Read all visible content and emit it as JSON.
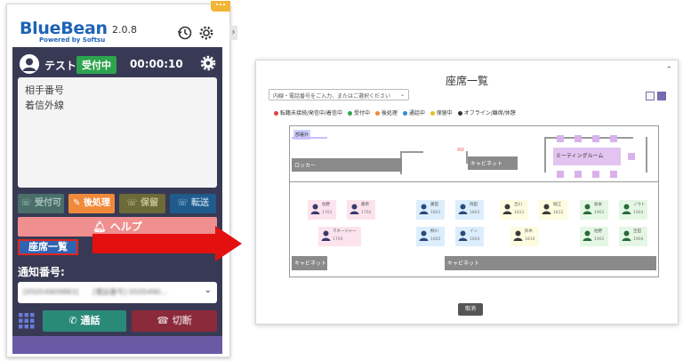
{
  "app": {
    "name": "BlueBean",
    "version": "2.0.8",
    "powered_by": "Powered by Softsu"
  },
  "user": {
    "name": "テスト",
    "status": "受付中",
    "timer": "00:00:10"
  },
  "call_info": {
    "line1": "相手番号",
    "line2": "着信外線"
  },
  "actions": {
    "receive": "受付可",
    "after": "後処理",
    "hold": "保留",
    "transfer": "転送",
    "help": "ヘルプ",
    "seat_list": "座席一覧"
  },
  "notify": {
    "label": "通知番号:",
    "value": "[05054909883]　　[電話番号] 0505490…"
  },
  "bottom": {
    "call": "通話",
    "hangup": "切断"
  },
  "seat_window": {
    "title": "座席一覧",
    "filter_placeholder": "内線・電話番号をご入力、またはご選択ください",
    "legend": [
      {
        "label": "転籍未接続/発信中/着信中",
        "color": "#e04040"
      },
      {
        "label": "受付中",
        "color": "#2da44e"
      },
      {
        "label": "後処理",
        "color": "#f08a3a"
      },
      {
        "label": "通話中",
        "color": "#2f8fd8"
      },
      {
        "label": "保留中",
        "color": "#e8c020"
      },
      {
        "label": "オフライン/離席/休憩",
        "color": "#333333"
      }
    ],
    "rooms": {
      "room_label": "部署外",
      "locker": "ロッカー",
      "cabinet_top": "キャビネット",
      "meeting": "ミーティングルーム",
      "cabinet_left": "キャビネット",
      "cabinet_bottom": "キャビネット"
    },
    "seats": [
      {
        "name": "佐野",
        "ext": "1701"
      },
      {
        "name": "藤原",
        "ext": "1702"
      },
      {
        "name": "マネージャー",
        "ext": "1700"
      },
      {
        "name": "藤田",
        "ext": "1801"
      },
      {
        "name": "岡田",
        "ext": "1803"
      },
      {
        "name": "柳川",
        "ext": "1802"
      },
      {
        "name": "イン",
        "ext": "1804"
      },
      {
        "name": "吉川",
        "ext": "1811"
      },
      {
        "name": "堀江",
        "ext": "1812"
      },
      {
        "name": "鈴木",
        "ext": "1810"
      },
      {
        "name": "坂本",
        "ext": "1901"
      },
      {
        "name": "ノウト",
        "ext": "1903"
      },
      {
        "name": "佐野",
        "ext": "1902"
      },
      {
        "name": "吉田",
        "ext": "1904"
      }
    ],
    "cancel": "取消"
  }
}
